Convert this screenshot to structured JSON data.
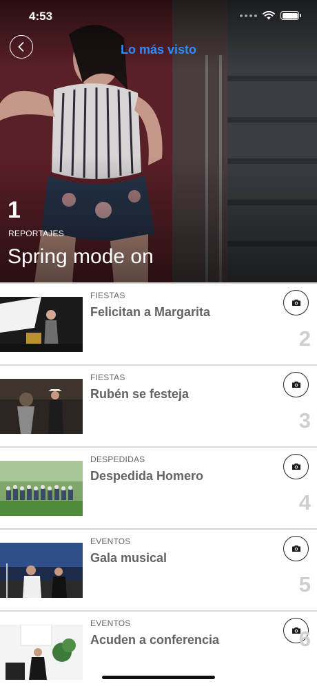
{
  "status_bar": {
    "time": "4:53"
  },
  "header": {
    "title": "Lo más visto"
  },
  "hero": {
    "rank": "1",
    "category": "REPORTAJES",
    "title": "Spring mode on"
  },
  "items": [
    {
      "rank": "2",
      "category": "FIESTAS",
      "title": "Felicitan a Margarita"
    },
    {
      "rank": "3",
      "category": "FIESTAS",
      "title": "Rubén se festeja"
    },
    {
      "rank": "4",
      "category": "DESPEDIDAS",
      "title": "Despedida Homero"
    },
    {
      "rank": "5",
      "category": "EVENTOS",
      "title": "Gala musical"
    },
    {
      "rank": "6",
      "category": "EVENTOS",
      "title": "Acuden a conferencia"
    }
  ],
  "icons": {
    "back": "chevron-left-icon",
    "gallery": "camera-icon",
    "wifi": "wifi-icon",
    "battery": "battery-icon"
  },
  "colors": {
    "header_title": "#2f8bff",
    "rank_number": "#cfcfcf",
    "item_title": "#636363"
  }
}
